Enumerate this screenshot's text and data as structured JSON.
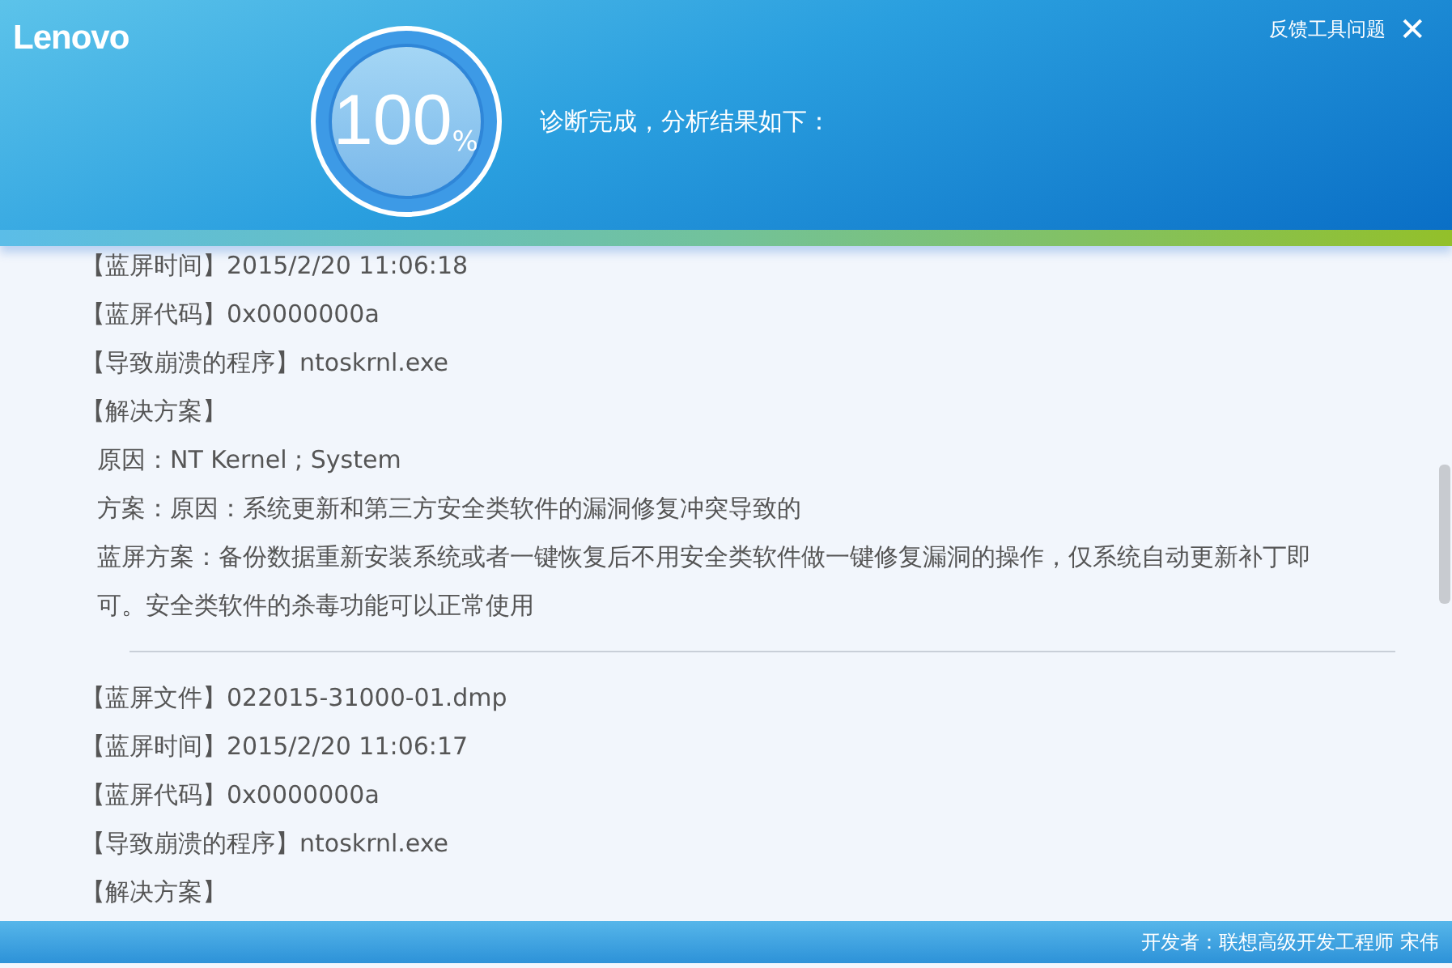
{
  "header": {
    "logo": "Lenovo",
    "feedback_link": "反馈工具问题",
    "close": "✕",
    "progress": {
      "value": "100",
      "unit": "%"
    },
    "status": "诊断完成，分析结果如下："
  },
  "reports": [
    {
      "lines": [
        {
          "kind": "field",
          "text": "【蓝屏时间】2015/2/20 11:06:18"
        },
        {
          "kind": "field",
          "text": "【蓝屏代码】0x0000000a"
        },
        {
          "kind": "field",
          "text": "【导致崩溃的程序】ntoskrnl.exe"
        },
        {
          "kind": "field",
          "text": "【解决方案】"
        },
        {
          "kind": "detail",
          "text": "原因：NT Kernel ; System"
        },
        {
          "kind": "detail",
          "text": "方案：原因：系统更新和第三方安全类软件的漏洞修复冲突导致的"
        },
        {
          "kind": "detail",
          "text": "蓝屏方案：备份数据重新安装系统或者一键恢复后不用安全类软件做一键修复漏洞的操作，仅系统自动更新补丁即可。安全类软件的杀毒功能可以正常使用"
        }
      ]
    },
    {
      "lines": [
        {
          "kind": "field",
          "text": "【蓝屏文件】022015-31000-01.dmp"
        },
        {
          "kind": "field",
          "text": "【蓝屏时间】2015/2/20 11:06:17"
        },
        {
          "kind": "field",
          "text": "【蓝屏代码】0x0000000a"
        },
        {
          "kind": "field",
          "text": "【导致崩溃的程序】ntoskrnl.exe"
        },
        {
          "kind": "field",
          "text": "【解决方案】"
        }
      ]
    }
  ],
  "footer": "开发者：联想高级开发工程师 宋伟"
}
